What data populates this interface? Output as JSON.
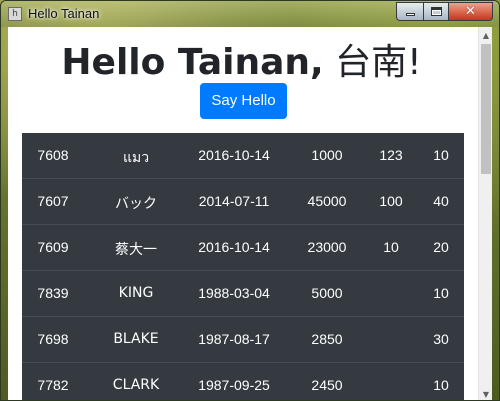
{
  "window": {
    "title": "Hello Tainan",
    "app_icon_glyph": "h",
    "controls": {
      "minimize_icon": "minimize-icon",
      "maximize_icon": "maximize-icon",
      "close_icon": "close-icon",
      "close_glyph": "✕"
    }
  },
  "page": {
    "heading_latin": "Hello Tainan,",
    "heading_cjk": "台南!",
    "button_label": "Say Hello",
    "accent_color": "#007bff",
    "table_bg_color": "#343a40"
  },
  "table": {
    "rows": [
      {
        "id": "7608",
        "name": "แมว",
        "date": "2016-10-14",
        "salary": "1000",
        "comm": "123",
        "dept": "10"
      },
      {
        "id": "7607",
        "name": "バック",
        "date": "2014-07-11",
        "salary": "45000",
        "comm": "100",
        "dept": "40"
      },
      {
        "id": "7609",
        "name": "蔡大一",
        "date": "2016-10-14",
        "salary": "23000",
        "comm": "10",
        "dept": "20"
      },
      {
        "id": "7839",
        "name": "KING",
        "date": "1988-03-04",
        "salary": "5000",
        "comm": "",
        "dept": "10"
      },
      {
        "id": "7698",
        "name": "BLAKE",
        "date": "1987-08-17",
        "salary": "2850",
        "comm": "",
        "dept": "30"
      },
      {
        "id": "7782",
        "name": "CLARK",
        "date": "1987-09-25",
        "salary": "2450",
        "comm": "",
        "dept": "10"
      }
    ]
  },
  "scrollbar": {
    "up_glyph": "▲",
    "down_glyph": "▼"
  }
}
